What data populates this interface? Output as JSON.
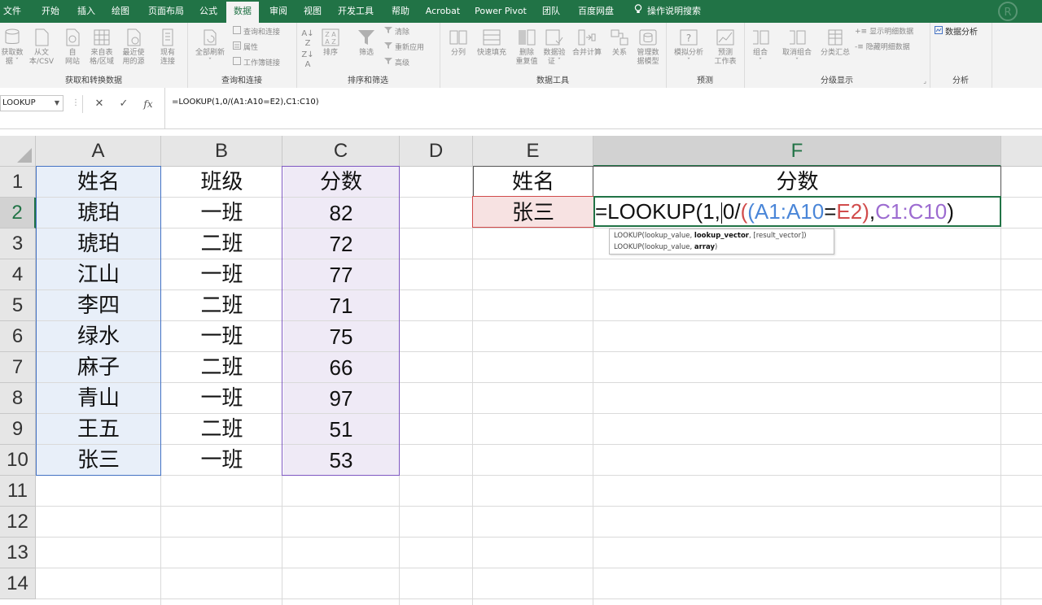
{
  "ribbon_tabs": [
    "文件",
    "开始",
    "插入",
    "绘图",
    "页面布局",
    "公式",
    "数据",
    "审阅",
    "视图",
    "开发工具",
    "帮助",
    "Acrobat",
    "Power Pivot",
    "团队",
    "百度网盘",
    "操作说明搜索"
  ],
  "active_tab": "数据",
  "ribbon": {
    "get_transform": {
      "label": "获取和转换数据",
      "get_data": "获取数\n据 ˇ",
      "from_csv": "从文\n本/CSV",
      "from_web": "自\n网站",
      "from_table": "来自表\n格/区域",
      "recent_sources": "最近使\n用的源",
      "existing_conn": "现有\n连接"
    },
    "queries": {
      "label": "查询和连接",
      "refresh_all": "全部刷新\nˇ",
      "queries_conn": "查询和连接",
      "properties": "属性",
      "edit_links": "工作簿链接"
    },
    "sort_filter": {
      "label": "排序和筛选",
      "sort": "排序",
      "filter": "筛选",
      "clear": "清除",
      "reapply": "重新应用",
      "advanced": "高级"
    },
    "data_tools": {
      "label": "数据工具",
      "text_to_cols": "分列",
      "flash_fill": "快速填充",
      "remove_dup": "删除\n重复值",
      "validation": "数据验\n证 ˇ",
      "consolidate": "合并计算",
      "relationships": "关系",
      "data_model": "管理数\n据模型"
    },
    "forecast": {
      "label": "预测",
      "whatif": "模拟分析\nˇ",
      "forecast_sheet": "预测\n工作表"
    },
    "outline": {
      "label": "分级显示",
      "group": "组合\nˇ",
      "ungroup": "取消组合\nˇ",
      "subtotal": "分类汇总",
      "show_detail": "显示明细数据",
      "hide_detail": "隐藏明细数据"
    },
    "analysis": {
      "label": "分析",
      "data_analysis": "数据分析"
    }
  },
  "formula_bar": {
    "name_box": "LOOKUP",
    "formula": "=LOOKUP(1,0/(A1:A10=E2),C1:C10)"
  },
  "columns": [
    "A",
    "B",
    "C",
    "D",
    "E",
    "F"
  ],
  "rows": [
    "1",
    "2",
    "3",
    "4",
    "5",
    "6",
    "7",
    "8",
    "9",
    "10",
    "11",
    "12",
    "13",
    "14"
  ],
  "table_left": {
    "headers": [
      "姓名",
      "班级",
      "分数"
    ],
    "rows": [
      [
        "琥珀",
        "一班",
        "82"
      ],
      [
        "琥珀",
        "二班",
        "72"
      ],
      [
        "江山",
        "一班",
        "77"
      ],
      [
        "李四",
        "二班",
        "71"
      ],
      [
        "绿水",
        "一班",
        "75"
      ],
      [
        "麻子",
        "二班",
        "66"
      ],
      [
        "青山",
        "一班",
        "97"
      ],
      [
        "王五",
        "二班",
        "51"
      ],
      [
        "张三",
        "一班",
        "53"
      ]
    ]
  },
  "table_right": {
    "header_name": "姓名",
    "header_score": "分数",
    "lookup_name": "张三"
  },
  "edit_cell": {
    "p1": "=LOOKUP(1,",
    "p2": "0/",
    "p3": "(A1:A10",
    "p4": "=",
    "p5": "E2)",
    "p6": ",",
    "p7": "C1:C10",
    "p8": ")"
  },
  "tooltip": {
    "line1_a": "LOOKUP(lookup_value, ",
    "line1_b": "lookup_vector",
    "line1_c": ", [result_vector])",
    "line2_a": "LOOKUP(lookup_value, ",
    "line2_b": "array",
    "line2_c": ")"
  },
  "colors": {
    "excel_green": "#217346",
    "range_blue": "#4472c4",
    "range_red": "#d14b4b",
    "range_purple": "#7e57c2"
  }
}
